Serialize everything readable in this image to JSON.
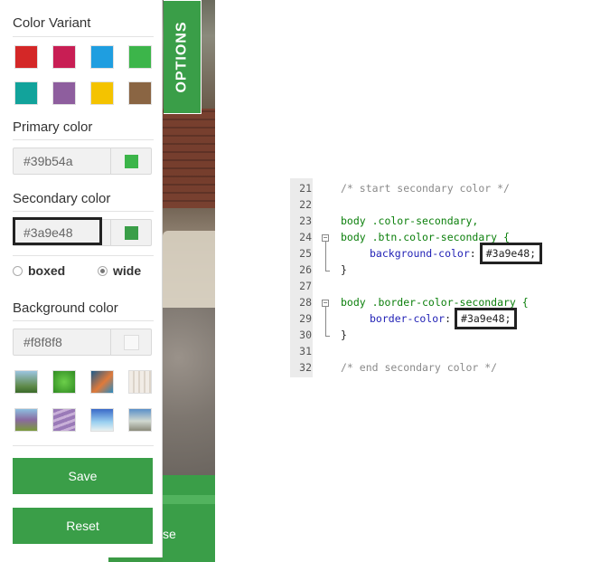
{
  "panel": {
    "color_variant_title": "Color Variant",
    "swatches": [
      "#d42727",
      "#c81e54",
      "#1f9ee0",
      "#3cb54a",
      "#12a39b",
      "#8e5e9e",
      "#f4c300",
      "#8a6543"
    ],
    "primary_title": "Primary color",
    "primary_value": "#39b54a",
    "primary_swatch": "#3cb54a",
    "secondary_title": "Secondary color",
    "secondary_value": "#3a9e48",
    "secondary_swatch": "#3a9e48",
    "layout_options": [
      {
        "label": "boxed",
        "selected": false
      },
      {
        "label": "wide",
        "selected": true
      }
    ],
    "background_title": "Background color",
    "background_value": "#f8f8f8",
    "background_swatch": "#f8f8f8",
    "save_label": "Save",
    "reset_label": "Reset"
  },
  "options_tab_label": "OPTIONS",
  "site_fragment_text": "se",
  "code": {
    "lines": [
      {
        "n": "21",
        "text": "/* start secondary color */",
        "type": "comment"
      },
      {
        "n": "22",
        "text": "",
        "type": "blank"
      },
      {
        "n": "23",
        "text": "body .color-secondary,",
        "type": "selector"
      },
      {
        "n": "24",
        "text": "body .btn.color-secondary {",
        "type": "selector"
      },
      {
        "n": "25",
        "prop": "background-color",
        "value": "#3a9e48;",
        "type": "decl"
      },
      {
        "n": "26",
        "text": "}",
        "type": "close"
      },
      {
        "n": "27",
        "text": "",
        "type": "blank"
      },
      {
        "n": "28",
        "text": "body .border-color-secondary {",
        "type": "selector"
      },
      {
        "n": "29",
        "prop": "border-color",
        "value": "#3a9e48;",
        "type": "decl"
      },
      {
        "n": "30",
        "text": "}",
        "type": "close"
      },
      {
        "n": "31",
        "text": "",
        "type": "blank"
      },
      {
        "n": "32",
        "text": "/* end secondary color */",
        "type": "comment"
      }
    ]
  }
}
